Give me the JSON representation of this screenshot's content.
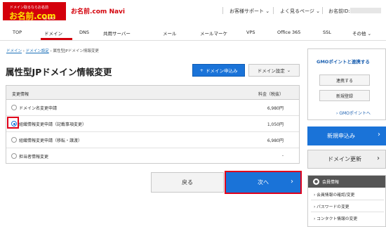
{
  "header": {
    "logo_small": "ドメイン取るならお名前",
    "logo_main": "お名前.com",
    "logo_sub": "by GMO",
    "navi_title": "お名前.com Navi",
    "support_link": "お客様サポート",
    "faq_link": "よく見るページ",
    "user_id_label": "お名前ID:"
  },
  "tabs": [
    "TOP",
    "ドメイン",
    "DNS",
    "共用サーバー",
    "メール",
    "メールマーケ",
    "VPS",
    "Office 365",
    "SSL",
    "その他"
  ],
  "breadcrumb": {
    "items": [
      "ドメイン",
      "ドメイン設定",
      "属性型JPドメイン情報変更"
    ]
  },
  "page": {
    "title": "属性型JPドメイン情報変更",
    "apply_button": "ドメイン申込み",
    "settings_button": "ドメイン設定"
  },
  "table": {
    "header_left": "変更情報",
    "header_right": "料金（税抜）",
    "rows": [
      {
        "label": "ドメイン名変更申請",
        "price": "6,980円"
      },
      {
        "label": "組織情報変更申請（記載事項変更）",
        "price": "1,050円"
      },
      {
        "label": "組織情報変更申請（移転・譲渡）",
        "price": "6,980円"
      },
      {
        "label": "担当者情報変更",
        "price": "-"
      }
    ],
    "selected_index": 1
  },
  "actions": {
    "back": "戻る",
    "next": "次へ"
  },
  "sidebar": {
    "gmo_title": "GMOポイントと連携する",
    "link_button": "連携する",
    "register_button": "新規登録",
    "gmo_point_link": "GMOポイントへ",
    "new_app_button": "新規申込み",
    "renew_button": "ドメイン更新",
    "member_title": "会員情報",
    "member_links": [
      "会員情報の確認/変更",
      "パスワードの変更",
      "コンタクト情報の変更"
    ]
  },
  "colors": {
    "brand_red": "#d4000b",
    "primary_blue": "#1a73d8",
    "highlight": "#e0001b"
  }
}
